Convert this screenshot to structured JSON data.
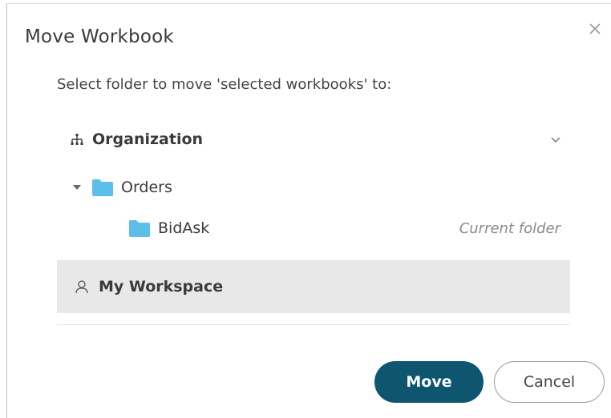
{
  "dialog": {
    "title": "Move Workbook",
    "subtitle": "Select folder to move 'selected workbooks' to:"
  },
  "tree": {
    "organization": {
      "label": "Organization",
      "icon": "hierarchy-icon",
      "expanded": true
    },
    "folders": [
      {
        "label": "Orders",
        "icon": "folder-icon",
        "expanded": true
      },
      {
        "label": "BidAsk",
        "icon": "folder-icon",
        "note": "Current folder"
      }
    ],
    "workspace": {
      "label": "My Workspace",
      "icon": "user-icon",
      "selected": true
    }
  },
  "buttons": {
    "move": "Move",
    "cancel": "Cancel"
  },
  "colors": {
    "primary": "#0e5670",
    "folder": "#5bbfe9",
    "selected_row": "#e8e8e8"
  }
}
